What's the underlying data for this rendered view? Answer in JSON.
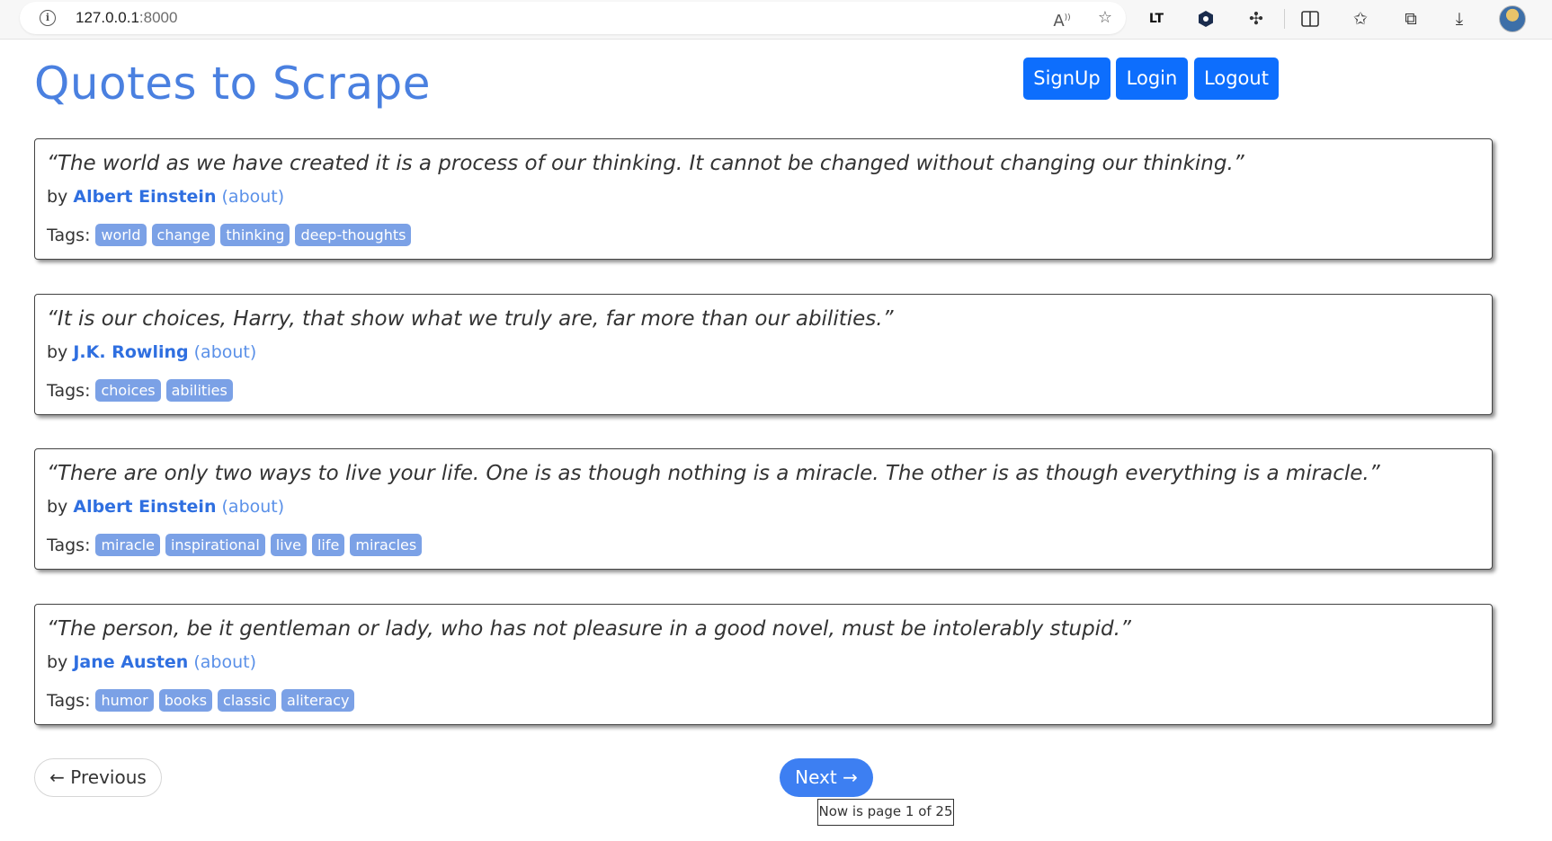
{
  "browser": {
    "url_host": "127.0.0.1",
    "url_port": ":8000",
    "icons": [
      "info-icon",
      "read-aloud-icon",
      "favorite-star-icon",
      "lt-extension-icon",
      "shield-extension-icon",
      "extensions-puzzle-icon",
      "split-screen-icon",
      "favorites-list-icon",
      "collections-icon",
      "download-icon",
      "profile-avatar"
    ]
  },
  "header": {
    "title": "Quotes to Scrape",
    "signup_label": "SignUp",
    "login_label": "Login",
    "logout_label": "Logout"
  },
  "quotes": [
    {
      "text": "“The world as we have created it is a process of our thinking. It cannot be changed without changing our thinking.”",
      "by": "by",
      "author": "Albert Einstein",
      "about": "(about)",
      "tags_label": "Tags:",
      "tags": [
        "world",
        "change",
        "thinking",
        "deep-thoughts"
      ]
    },
    {
      "text": "“It is our choices, Harry, that show what we truly are, far more than our abilities.”",
      "by": "by",
      "author": "J.K. Rowling",
      "about": "(about)",
      "tags_label": "Tags:",
      "tags": [
        "choices",
        "abilities"
      ]
    },
    {
      "text": "“There are only two ways to live your life. One is as though nothing is a miracle. The other is as though everything is a miracle.”",
      "by": "by",
      "author": "Albert Einstein",
      "about": "(about)",
      "tags_label": "Tags:",
      "tags": [
        "miracle",
        "inspirational",
        "live",
        "life",
        "miracles"
      ]
    },
    {
      "text": "“The person, be it gentleman or lady, who has not pleasure in a good novel, must be intolerably stupid.”",
      "by": "by",
      "author": "Jane Austen",
      "about": "(about)",
      "tags_label": "Tags:",
      "tags": [
        "humor",
        "books",
        "classic",
        "aliteracy"
      ]
    }
  ],
  "pagination": {
    "previous_label": "← Previous",
    "next_label": "Next →",
    "page_status": "Now is page 1 of 25"
  },
  "colors": {
    "title": "#4a80e0",
    "auth_button": "#0d6efd",
    "tag_bg": "#7ba1e6",
    "author": "#2f6fe0",
    "next_button": "#3d7ff2"
  }
}
